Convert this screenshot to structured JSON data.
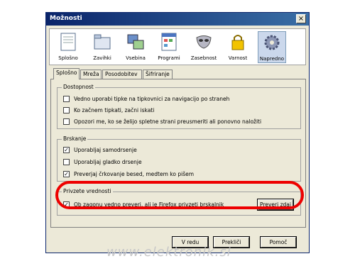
{
  "window": {
    "title": "Možnosti",
    "close": "×"
  },
  "toolbar": {
    "items": [
      {
        "label": "Splošno",
        "icon": "general-icon"
      },
      {
        "label": "Zavihki",
        "icon": "tabs-icon"
      },
      {
        "label": "Vsebina",
        "icon": "content-icon"
      },
      {
        "label": "Programi",
        "icon": "applications-icon"
      },
      {
        "label": "Zasebnost",
        "icon": "privacy-mask-icon"
      },
      {
        "label": "Varnost",
        "icon": "security-lock-icon"
      },
      {
        "label": "Napredno",
        "icon": "advanced-gear-icon"
      }
    ],
    "active": "Napredno"
  },
  "tabs": [
    "Splošno",
    "Mreža",
    "Posodobitev",
    "Šifriranje"
  ],
  "accessibility": {
    "title": "Dostopnost",
    "options": [
      {
        "label": "Vedno uporabi tipke na tipkovnici za navigacijo po straneh",
        "checked": false
      },
      {
        "label": "Ko začnem tipkati, začni iskati",
        "checked": false
      },
      {
        "label": "Opozori me, ko se želijo spletne strani preusmeriti ali ponovno naložiti",
        "checked": false
      }
    ]
  },
  "browsing": {
    "title": "Brskanje",
    "options": [
      {
        "label": "Uporabljaj samodrsenje",
        "checked": true
      },
      {
        "label": "Uporabljaj gladko drsenje",
        "checked": false
      },
      {
        "label": "Preverjaj črkovanje besed, medtem ko pišem",
        "checked": true
      }
    ]
  },
  "system_defaults": {
    "title": "Privzete vrednosti",
    "option": {
      "label": "Ob zagonu vedno preveri, ali je Firefox privzeti brskalnik",
      "checked": true
    },
    "check_now": "Preveri zdaj"
  },
  "buttons": {
    "ok": "V redu",
    "cancel": "Prekliči",
    "help": "Pomoč"
  },
  "watermark": "www.elektronik.si",
  "annotation_color": "#ee0000"
}
